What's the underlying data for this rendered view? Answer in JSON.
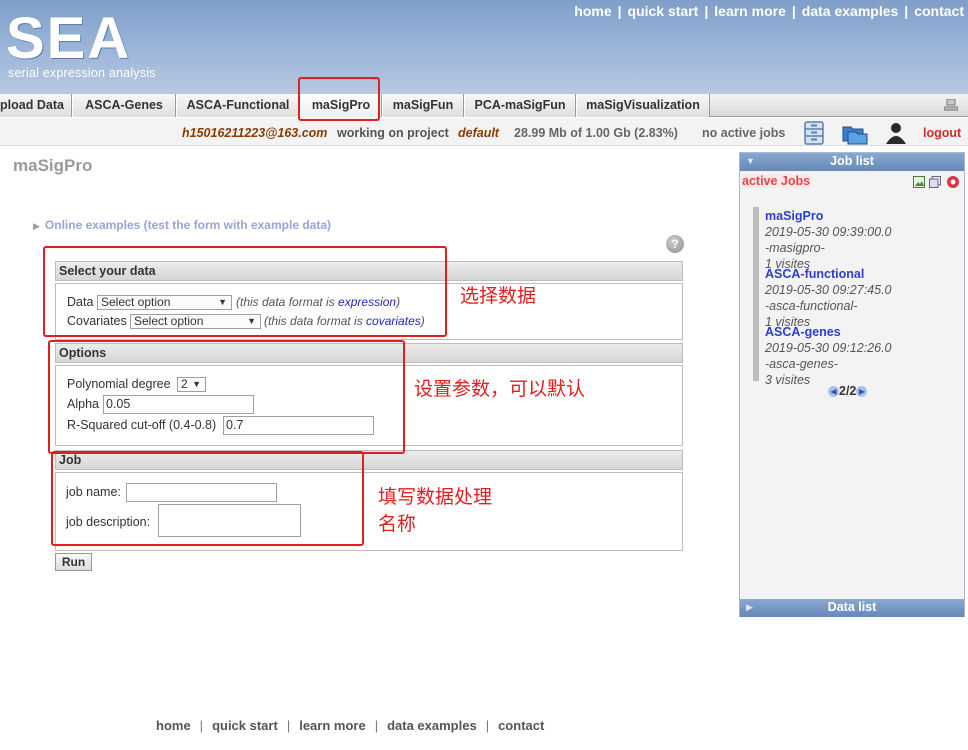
{
  "header": {
    "logo": "SEA",
    "logo_subtitle": "serial expression analysis",
    "nav": [
      "home",
      "quick start",
      "learn more",
      "data examples",
      "contact"
    ]
  },
  "tabs": [
    "pload Data",
    "ASCA-Genes",
    "ASCA-Functional",
    "maSigPro",
    "maSigFun",
    "PCA-maSigFun",
    "maSigVisualization"
  ],
  "status": {
    "user": "h15016211223@163.com",
    "working": "working on project",
    "project": "default",
    "storage": "28.99 Mb of 1.00 Gb (2.83%)",
    "jobs": "no active jobs",
    "logout": "logout"
  },
  "page": {
    "title": "maSigPro",
    "online_examples": "Online examples (test the form with example data)",
    "help": "?"
  },
  "select_section": {
    "title": "Select your data",
    "data_label": "Data",
    "data_value": "Select option",
    "data_note_prefix": "(this data format is ",
    "data_note_link": "expression",
    "data_note_suffix": ")",
    "cov_label": "Covariates",
    "cov_value": "Select option",
    "cov_note_prefix": "(this data format is ",
    "cov_note_link": "covariates",
    "cov_note_suffix": ")"
  },
  "options_section": {
    "title": "Options",
    "poly_label": "Polynomial degree",
    "poly_value": "2",
    "alpha_label": "Alpha",
    "alpha_value": "0.05",
    "rsq_label": "R-Squared cut-off (0.4-0.8)",
    "rsq_value": "0.7"
  },
  "job_section": {
    "title": "Job",
    "name_label": "job name:",
    "name_value": "",
    "desc_label": "job description:",
    "desc_value": ""
  },
  "run_label": "Run",
  "annotations": {
    "select": "选择数据",
    "options": "设置参数，可以默认",
    "job_line1": "填写数据处理",
    "job_line2": "名称"
  },
  "sidebar": {
    "job_list_title": "Job list",
    "active_jobs": "active Jobs",
    "jobs": [
      {
        "name": "maSigPro",
        "date": "2019-05-30 09:39:00.0",
        "tag": "-masigpro-",
        "visits": "1 visites"
      },
      {
        "name": "ASCA-functional",
        "date": "2019-05-30 09:27:45.0",
        "tag": "-asca-functional-",
        "visits": "1 visites"
      },
      {
        "name": "ASCA-genes",
        "date": "2019-05-30 09:12:26.0",
        "tag": "-asca-genes-",
        "visits": "3 visites"
      }
    ],
    "pager": "2/2",
    "data_list_title": "Data list"
  },
  "footer": [
    "home",
    "quick start",
    "learn more",
    "data examples",
    "contact"
  ],
  "colors": {
    "header_blue": "#8aa7cf",
    "annotation_red": "#e21e1e",
    "link_blue": "#2c3fd0",
    "user_brown": "#8b3a00",
    "logout_red": "#d52a2a"
  }
}
